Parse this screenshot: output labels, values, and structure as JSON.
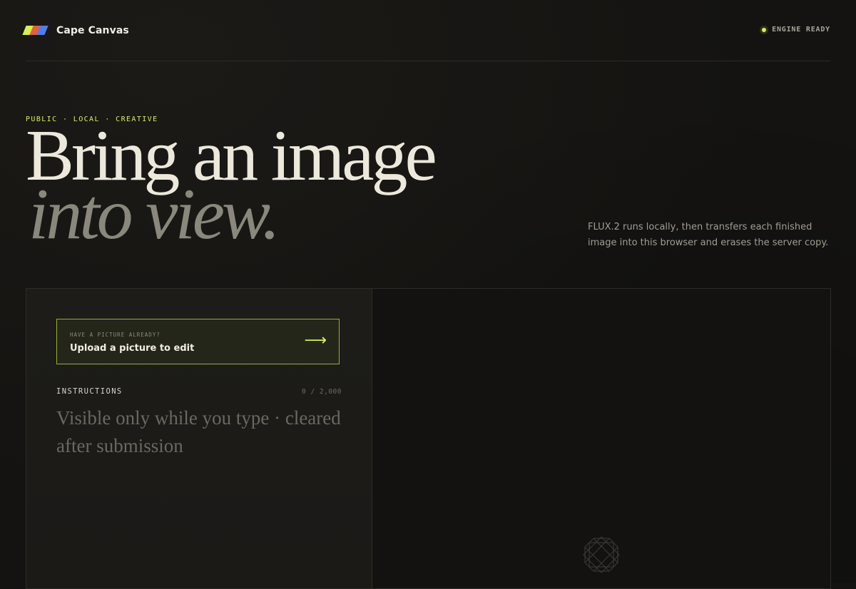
{
  "header": {
    "brand_name": "Cape Canvas",
    "logo_colors": [
      "#d7f24a",
      "#e2603c",
      "#4f7ee8"
    ],
    "status_text": "ENGINE READY",
    "status_color": "#d7f24a"
  },
  "hero": {
    "kicker": "PUBLIC · LOCAL · CREATIVE",
    "headline_line1": "Bring an image",
    "headline_line2": "into view.",
    "description": "FLUX.2 runs locally, then transfers each finished image into this browser and erases the server copy."
  },
  "editor": {
    "upload_kicker": "HAVE A PICTURE ALREADY?",
    "upload_label": "Upload a picture to edit",
    "upload_icon": "arrow-right-icon",
    "instructions_label": "INSTRUCTIONS",
    "instructions_count": "0 / 2,000",
    "instructions_placeholder": "Visible only while you type · cleared after submission",
    "instructions_value": ""
  },
  "preview": {
    "placeholder_icon": "geometric-knot-icon"
  },
  "accent_color": "#d7ef5b"
}
